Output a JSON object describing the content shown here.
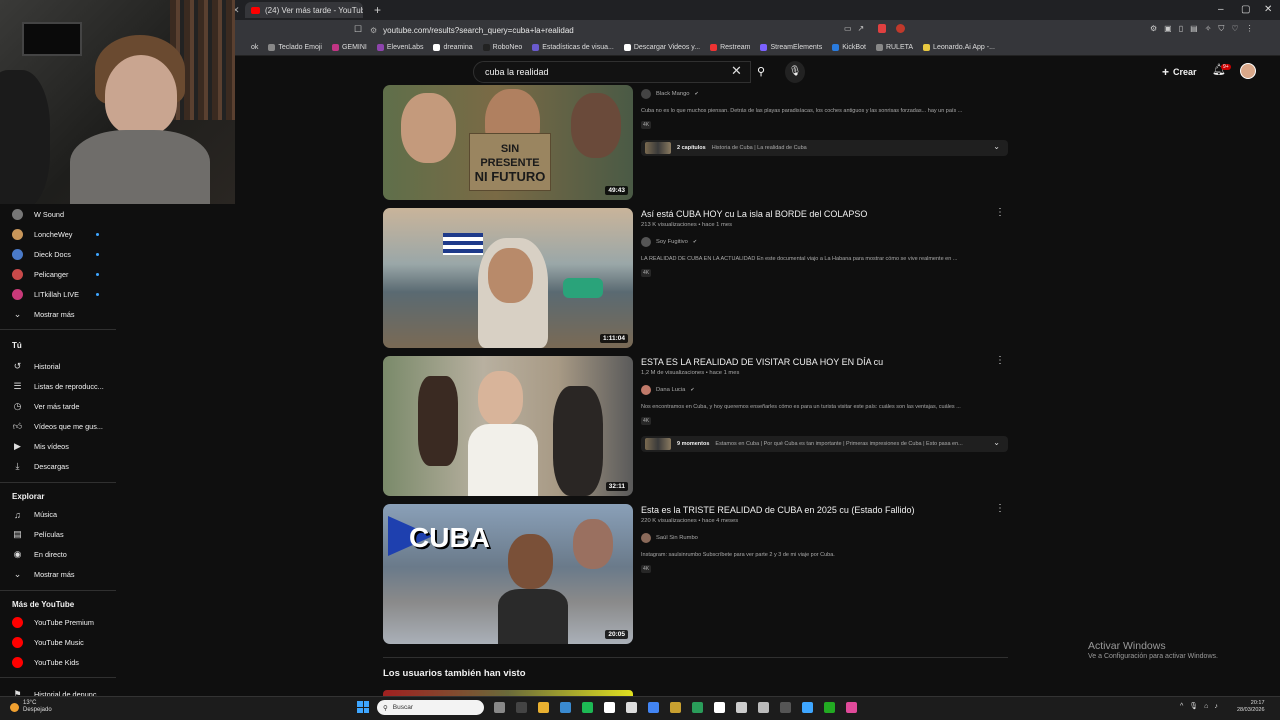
{
  "browser": {
    "tab_title": "(24) Ver más tarde - YouTube",
    "url": "youtube.com/results?search_query=cuba+la+realidad",
    "bookmarks": [
      "ok",
      "Teclado Emoji",
      "GEMINI",
      "ElevenLabs",
      "dreamina",
      "RoboNeo",
      "Estadísticas de visua...",
      "Descargar Videos y...",
      "Restream",
      "StreamElements",
      "KickBot",
      "RULETA",
      "Leonardo.Ai App -..."
    ]
  },
  "header": {
    "search_value": "cuba la realidad",
    "create_label": "Crear",
    "notification_badge": "9+"
  },
  "sidebar": {
    "subscriptions": [
      {
        "label": "W Sound",
        "color": "#777777",
        "new": false
      },
      {
        "label": "LoncheWey",
        "color": "#c8965a",
        "new": true
      },
      {
        "label": "Dieck Docs",
        "color": "#4a7ac8",
        "new": true
      },
      {
        "label": "Pelicanger",
        "color": "#c84a4a",
        "new": true
      },
      {
        "label": "LITkillah LIVE",
        "color": "#c83a7a",
        "new": true
      }
    ],
    "show_more_1": "Mostrar más",
    "you_heading": "Tú",
    "you_items": [
      "Historial",
      "Listas de reproducc...",
      "Ver más tarde",
      "Vídeos que me gus...",
      "Mis vídeos",
      "Descargas"
    ],
    "explore_heading": "Explorar",
    "explore_items": [
      "Música",
      "Películas",
      "En directo"
    ],
    "show_more_2": "Mostrar más",
    "more_heading": "Más de YouTube",
    "more_items": [
      "YouTube Premium",
      "YouTube Music",
      "YouTube Kids"
    ],
    "cutoff_item": "Historial de denunc..."
  },
  "videos": [
    {
      "title": "",
      "meta": "",
      "channel": "Black Mango",
      "description": "Cuba no es lo que muchos piensan. Detrás de las playas paradisíacas, los coches antiguos y las sonrisas forzadas... hay un país ...",
      "badge": "4K",
      "duration": "49:43",
      "thumb_text": [
        "SIN PRESENTE",
        "NI FUTURO"
      ],
      "chapters_count": "2 capítulos",
      "chapters_text": "Historia de Cuba | La realidad de Cuba"
    },
    {
      "title": "Así está CUBA HOY cu La isla al BORDE del COLAPSO",
      "meta": "213 K visualizaciones • hace 1 mes",
      "channel": "Soy Fugitivo",
      "description": "LA REALIDAD DE CUBA EN LA ACTUALIDAD En este documental viajo a La Habana para mostrar cómo se vive realmente en ...",
      "badge": "4K",
      "duration": "1:11:04"
    },
    {
      "title": "ESTA ES LA REALIDAD DE VISITAR CUBA HOY EN DÍA cu",
      "meta": "1,2 M de visualizaciones • hace 1 mes",
      "channel": "Dana Lucia",
      "description": "Nos encontramos en Cuba, y hoy queremos enseñarles cómo es para un turista visitar este país: cuáles son las ventajas, cuáles ...",
      "badge": "4K",
      "duration": "32:11",
      "chapters_count": "9 momentos",
      "chapters_text": "Estamos en Cuba | Por qué Cuba es tan importante | Primeras impresiones de Cuba | Esto pasa en..."
    },
    {
      "title": "Esta es la TRISTE REALIDAD de CUBA en 2025 cu (Estado Fallido)",
      "meta": "220 K visualizaciones • hace 4 meses",
      "channel": "Saúl Sin Rumbo",
      "description": "Instagram: saulsinrumbo Subscríbete para ver parte 2 y 3 de mi viaje por Cuba.",
      "badge": "4K",
      "duration": "20:05",
      "thumb_text": [
        "CUBA"
      ]
    }
  ],
  "section_heading": "Los usuarios también han visto",
  "watermark": {
    "line1": "Activar Windows",
    "line2": "Ve a Configuración para activar Windows."
  },
  "taskbar": {
    "weather_temp": "13°C",
    "weather_desc": "Despejado",
    "search_placeholder": "Buscar",
    "time": "20:17",
    "date": "28/03/2026"
  },
  "icons": {
    "verified": "✔",
    "kebab": "⋮",
    "chevron": "⌄"
  }
}
